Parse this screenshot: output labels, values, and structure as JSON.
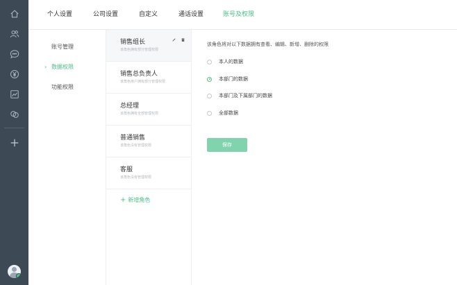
{
  "sidebar_icons": [
    {
      "name": "home-icon"
    },
    {
      "name": "contacts-icon"
    },
    {
      "name": "chat-icon"
    },
    {
      "name": "yen-icon"
    },
    {
      "name": "chart-icon"
    },
    {
      "name": "link-icon"
    },
    {
      "name": "add-icon"
    }
  ],
  "topnav": {
    "tabs": [
      "个人设置",
      "公司设置",
      "自定义",
      "通话设置",
      "账号及权限"
    ],
    "active_index": 4
  },
  "subnav": {
    "items": [
      "账号管理",
      "数据权限",
      "功能权限"
    ],
    "active_index": 1
  },
  "roles": {
    "items": [
      {
        "name": "销售组长",
        "desc": "该角色拥有部分管理权限"
      },
      {
        "name": "销售总负责人",
        "desc": "该角色用户拥有部分管理权限"
      },
      {
        "name": "总经理",
        "desc": "该角色拥有全部管理权限"
      },
      {
        "name": "普通销售",
        "desc": "该角色没有管理权限"
      },
      {
        "name": "客服",
        "desc": "该角色没有管理权限"
      }
    ],
    "active_index": 0,
    "add_label": "新增角色"
  },
  "main": {
    "intro": "该角色将对以下数据拥有查看、编辑、新增、删除的权限",
    "options": [
      "本人的数据",
      "本部门的数据",
      "本部门及下属部门的数据",
      "全部数据"
    ],
    "selected_index": 1,
    "save_label": "保存"
  },
  "colors": {
    "accent": "#4cc08a",
    "rail": "#3d4a56",
    "save_button": "#80d3ac"
  }
}
